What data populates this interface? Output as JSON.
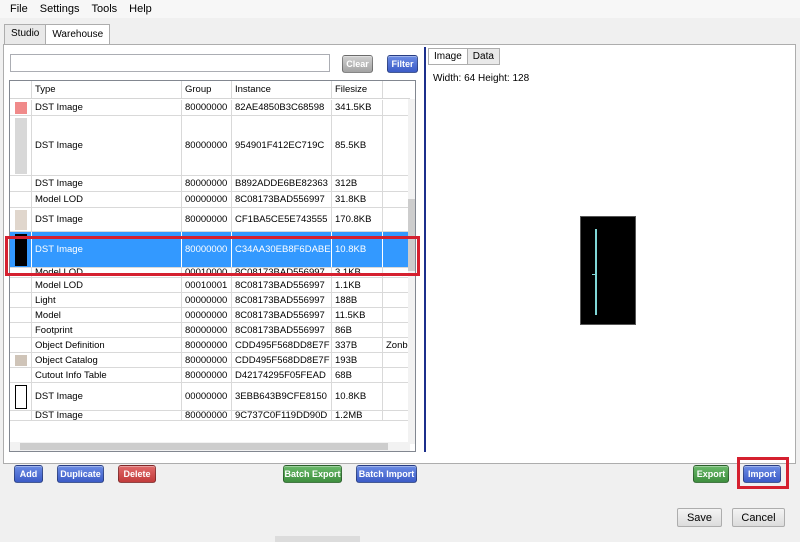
{
  "menu": [
    "File",
    "Settings",
    "Tools",
    "Help"
  ],
  "tabs": [
    "Studio",
    "Warehouse"
  ],
  "search": {
    "value": "",
    "placeholder": ""
  },
  "buttons": {
    "clear": "Clear",
    "filter": "Filter",
    "add": "Add",
    "duplicate": "Duplicate",
    "delete": "Delete",
    "batch_export": "Batch Export",
    "batch_import": "Batch Import",
    "export": "Export",
    "import": "Import",
    "save": "Save",
    "cancel": "Cancel"
  },
  "grid": {
    "headers": [
      "Type",
      "Group",
      "Instance",
      "Filesize",
      ""
    ],
    "rows": [
      {
        "type": "DST Image",
        "group": "80000000",
        "instance": "82AE4850B3C68598",
        "filesize": "341.5KB",
        "extra": "",
        "thumb": "#f08a8a"
      },
      {
        "type": "DST Image",
        "group": "80000000",
        "instance": "954901F412EC719C",
        "filesize": "85.5KB",
        "extra": "",
        "thumb": "#d8d8d8"
      },
      {
        "type": "DST Image",
        "group": "80000000",
        "instance": "B892ADDE6BE82363",
        "filesize": "312B",
        "extra": "",
        "thumb": ""
      },
      {
        "type": "Model LOD",
        "group": "00000000",
        "instance": "8C08173BAD556997",
        "filesize": "31.8KB",
        "extra": "",
        "thumb": ""
      },
      {
        "type": "DST Image",
        "group": "80000000",
        "instance": "CF1BA5CE5E743555",
        "filesize": "170.8KB",
        "extra": "",
        "thumb": "#e0d6cc"
      },
      {
        "type": "DST Image",
        "group": "80000000",
        "instance": "C34AA30EB8F6DABE",
        "filesize": "10.8KB",
        "extra": "",
        "thumb": "#000000"
      },
      {
        "type": "Model LOD",
        "group": "00010000",
        "instance": "8C08173BAD556997",
        "filesize": "3.1KB",
        "extra": "",
        "thumb": ""
      },
      {
        "type": "Model LOD",
        "group": "00010001",
        "instance": "8C08173BAD556997",
        "filesize": "1.1KB",
        "extra": "",
        "thumb": ""
      },
      {
        "type": "Light",
        "group": "00000000",
        "instance": "8C08173BAD556997",
        "filesize": "188B",
        "extra": "",
        "thumb": ""
      },
      {
        "type": "Model",
        "group": "00000000",
        "instance": "8C08173BAD556997",
        "filesize": "11.5KB",
        "extra": "",
        "thumb": ""
      },
      {
        "type": "Footprint",
        "group": "80000000",
        "instance": "8C08173BAD556997",
        "filesize": "86B",
        "extra": "",
        "thumb": ""
      },
      {
        "type": "Object Definition",
        "group": "80000000",
        "instance": "CDD495F568DD8E7F",
        "filesize": "337B",
        "extra": "Zonbk",
        "thumb": ""
      },
      {
        "type": "Object Catalog",
        "group": "80000000",
        "instance": "CDD495F568DD8E7F",
        "filesize": "193B",
        "extra": "",
        "thumb": "#cfc4b8"
      },
      {
        "type": "Cutout Info Table",
        "group": "80000000",
        "instance": "D42174295F05FEAD",
        "filesize": "68B",
        "extra": "",
        "thumb": ""
      },
      {
        "type": "DST Image",
        "group": "00000000",
        "instance": "3EBB643B9CFE8150",
        "filesize": "10.8KB",
        "extra": "",
        "thumb": "#ffffff"
      },
      {
        "type": "DST Image",
        "group": "80000000",
        "instance": "9C737C0F119DD90D",
        "filesize": "1.2MB",
        "extra": "",
        "thumb": ""
      }
    ],
    "selected_index": 5
  },
  "right_tabs": [
    "Image",
    "Data"
  ],
  "image_info": "Width: 64 Height: 128",
  "colors": {
    "selection": "#3399ff",
    "highlight": "#d5202f",
    "divider": "#1c2f8c"
  }
}
